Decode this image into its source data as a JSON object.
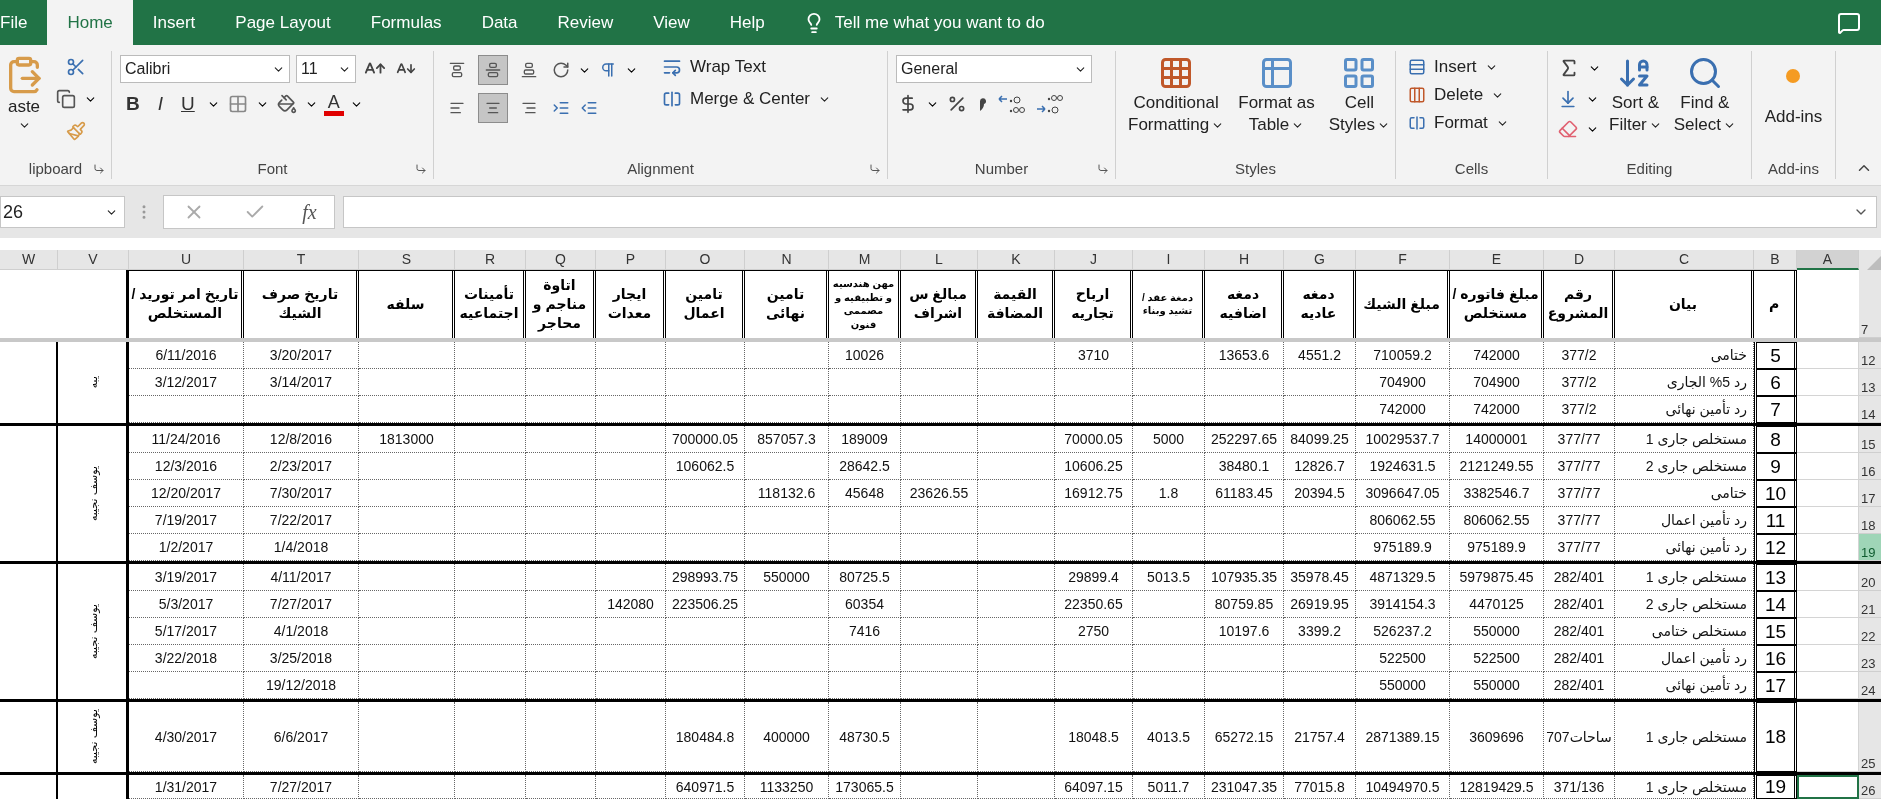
{
  "ribbon_tabs": [
    {
      "label": "File",
      "selected": false
    },
    {
      "label": "Home",
      "selected": true
    },
    {
      "label": "Insert",
      "selected": false
    },
    {
      "label": "Page Layout",
      "selected": false
    },
    {
      "label": "Formulas",
      "selected": false
    },
    {
      "label": "Data",
      "selected": false
    },
    {
      "label": "Review",
      "selected": false
    },
    {
      "label": "View",
      "selected": false
    },
    {
      "label": "Help",
      "selected": false
    }
  ],
  "tell_me": "Tell me what you want to do",
  "clipboard": {
    "paste_label": "aste",
    "group_label": "lipboard"
  },
  "font": {
    "name": "Calibri",
    "size": "11",
    "bold": "B",
    "italic": "I",
    "underline": "U",
    "font_color": "A",
    "group_label": "Font"
  },
  "alignment": {
    "buttons": [
      {
        "kind": "top",
        "on": false
      },
      {
        "kind": "middle",
        "on": true
      },
      {
        "kind": "bottom",
        "on": false
      },
      {
        "kind": "left",
        "on": false
      },
      {
        "kind": "center",
        "on": true
      },
      {
        "kind": "right",
        "on": false
      }
    ],
    "wrap_text": "Wrap Text",
    "merge_center": "Merge & Center",
    "group_label": "Alignment"
  },
  "number": {
    "format": "General",
    "group_label": "Number"
  },
  "styles": {
    "buttons": [
      {
        "lines": [
          "Conditional",
          "Formatting"
        ]
      },
      {
        "lines": [
          "Format as",
          "Table"
        ]
      },
      {
        "lines": [
          "Cell",
          "Styles"
        ]
      }
    ],
    "group_label": "Styles"
  },
  "cells": {
    "buttons": [
      "Insert",
      "Delete",
      "Format"
    ],
    "group_label": "Cells"
  },
  "editing": {
    "buttons": [
      {
        "lines": [
          "Sort &",
          "Filter"
        ]
      },
      {
        "lines": [
          "Find &",
          "Select"
        ]
      }
    ],
    "group_label": "Editing"
  },
  "add_ins": {
    "button": "Add-ins",
    "group_label": "Add-ins"
  },
  "formula_bar": {
    "name_box": "26",
    "fx": "fx"
  },
  "sheet": {
    "columns": [
      {
        "letter": "W",
        "selected": false
      },
      {
        "letter": "V",
        "selected": false
      },
      {
        "letter": "U",
        "selected": false
      },
      {
        "letter": "T",
        "selected": false
      },
      {
        "letter": "S",
        "selected": false
      },
      {
        "letter": "R",
        "selected": false
      },
      {
        "letter": "Q",
        "selected": false
      },
      {
        "letter": "P",
        "selected": false
      },
      {
        "letter": "O",
        "selected": false
      },
      {
        "letter": "N",
        "selected": false
      },
      {
        "letter": "M",
        "selected": false
      },
      {
        "letter": "L",
        "selected": false
      },
      {
        "letter": "K",
        "selected": false
      },
      {
        "letter": "J",
        "selected": false
      },
      {
        "letter": "I",
        "selected": false
      },
      {
        "letter": "H",
        "selected": false
      },
      {
        "letter": "G",
        "selected": false
      },
      {
        "letter": "F",
        "selected": false
      },
      {
        "letter": "E",
        "selected": false
      },
      {
        "letter": "D",
        "selected": false
      },
      {
        "letter": "C",
        "selected": false
      },
      {
        "letter": "B",
        "selected": false
      },
      {
        "letter": "A",
        "selected": true
      }
    ],
    "header_row": {
      "number": "7",
      "labels": {
        "U": {
          "text": "تاريخ امر توريد /المستخلص",
          "compact": false
        },
        "T": {
          "text": "تاريخ صرف الشيك",
          "compact": false
        },
        "S": {
          "text": "سلفه",
          "compact": false
        },
        "R": {
          "text": "تأمينات اجتماعيه",
          "compact": false
        },
        "Q": {
          "text": "اتاوة مناجم و محاجر",
          "compact": false
        },
        "P": {
          "text": "ايجار معدات",
          "compact": false
        },
        "O": {
          "text": "تامين اعمال",
          "compact": false
        },
        "N": {
          "text": "تامين نهائى",
          "compact": false
        },
        "M": {
          "text": "مهن هندسيه و تطبيقيه و مصممى فنون",
          "compact": true
        },
        "L": {
          "text": "مبالغ س اشراف",
          "compact": false
        },
        "K": {
          "text": "القيمة المضافة",
          "compact": false
        },
        "J": {
          "text": "ارباح تجاريه",
          "compact": false
        },
        "I": {
          "text": "دمغة عقد / تشيد وبناء",
          "compact": true
        },
        "H": {
          "text": "دمغه اضافيه",
          "compact": false
        },
        "G": {
          "text": "دمغه عاديه",
          "compact": false
        },
        "F": {
          "text": "مبلغ الشيك",
          "compact": false
        },
        "E": {
          "text": "مبلغ فاتوره / مستخلص",
          "compact": false
        },
        "D": {
          "text": "رقم المشروع",
          "compact": false
        },
        "C": {
          "text": "بيان",
          "compact": false
        },
        "B": {
          "text": "م",
          "compact": false
        }
      }
    },
    "groups": [
      {
        "label": "يبه",
        "rows": [
          {
            "number": "12",
            "selected": false,
            "active": false,
            "cells": {
              "U": "6/11/2016",
              "T": "3/20/2017",
              "M": "10026",
              "J": "3710",
              "H": "13653.6",
              "G": "4551.2",
              "F": "710059.2",
              "E": "742000",
              "D": "377/2",
              "C": "ختامى",
              "B": "5"
            }
          },
          {
            "number": "13",
            "selected": false,
            "active": false,
            "cells": {
              "U": "3/12/2017",
              "T": "3/14/2017",
              "F": "704900",
              "E": "704900",
              "D": "377/2",
              "C": "رد 5% الجارى",
              "B": "6"
            }
          },
          {
            "number": "14",
            "selected": false,
            "active": false,
            "cells": {
              "F": "742000",
              "E": "742000",
              "D": "377/2",
              "C": "رد تأمين نهائى",
              "B": "7"
            }
          }
        ]
      },
      {
        "label": "يوسف نجيبه",
        "rows": [
          {
            "number": "15",
            "selected": false,
            "active": false,
            "cells": {
              "U": "11/24/2016",
              "T": "12/8/2016",
              "S": "1813000",
              "O": "700000.05",
              "N": "857057.3",
              "M": "189009",
              "J": "70000.05",
              "I": "5000",
              "H": "252297.65",
              "G": "84099.25",
              "F": "10029537.7",
              "E": "14000001",
              "D": "377/77",
              "C": "مستخلص جارى 1",
              "B": "8"
            }
          },
          {
            "number": "16",
            "selected": false,
            "active": false,
            "cells": {
              "U": "12/3/2016",
              "T": "2/23/2017",
              "O": "106062.5",
              "M": "28642.5",
              "J": "10606.25",
              "H": "38480.1",
              "G": "12826.7",
              "F": "1924631.5",
              "E": "2121249.55",
              "D": "377/77",
              "C": "مستخلص جارى 2",
              "B": "9"
            }
          },
          {
            "number": "17",
            "selected": false,
            "active": false,
            "cells": {
              "U": "12/20/2017",
              "T": "7/30/2017",
              "N": "118132.6",
              "M": "45648",
              "L": "23626.55",
              "J": "16912.75",
              "I": "1.8",
              "H": "61183.45",
              "G": "20394.5",
              "F": "3096647.05",
              "E": "3382546.7",
              "D": "377/77",
              "C": "ختامى",
              "B": "10"
            }
          },
          {
            "number": "18",
            "selected": false,
            "active": false,
            "cells": {
              "U": "7/19/2017",
              "T": "7/22/2017",
              "F": "806062.55",
              "E": "806062.55",
              "D": "377/77",
              "C": "رد تأمين اعمال",
              "B": "11"
            }
          },
          {
            "number": "19",
            "selected": true,
            "active": false,
            "cells": {
              "U": "1/2/2017",
              "T": "1/4/2018",
              "F": "975189.9",
              "E": "975189.9",
              "D": "377/77",
              "C": "رد تأمين نهائى",
              "B": "12"
            }
          }
        ]
      },
      {
        "label": "يوسف نجيبه",
        "rows": [
          {
            "number": "20",
            "selected": false,
            "active": false,
            "cells": {
              "U": "3/19/2017",
              "T": "4/11/2017",
              "O": "298993.75",
              "N": "550000",
              "M": "80725.5",
              "J": "29899.4",
              "I": "5013.5",
              "H": "107935.35",
              "G": "35978.45",
              "F": "4871329.5",
              "E": "5979875.45",
              "D": "282/401",
              "C": "مستخلص جارى 1",
              "B": "13"
            }
          },
          {
            "number": "21",
            "selected": false,
            "active": false,
            "cells": {
              "U": "5/3/2017",
              "T": "7/27/2017",
              "P": "142080",
              "O": "223506.25",
              "M": "60354",
              "J": "22350.65",
              "H": "80759.85",
              "G": "26919.95",
              "F": "3914154.3",
              "E": "4470125",
              "D": "282/401",
              "C": "مستخلص جارى 2",
              "B": "14"
            }
          },
          {
            "number": "22",
            "selected": false,
            "active": false,
            "cells": {
              "U": "5/17/2017",
              "T": "4/1/2018",
              "M": "7416",
              "J": "2750",
              "H": "10197.6",
              "G": "3399.2",
              "F": "526237.2",
              "E": "550000",
              "D": "282/401",
              "C": "مستخلص ختامى",
              "B": "15"
            }
          },
          {
            "number": "23",
            "selected": false,
            "active": false,
            "cells": {
              "U": "3/22/2018",
              "T": "3/25/2018",
              "F": "522500",
              "E": "522500",
              "D": "282/401",
              "C": "رد تأمين اعمال",
              "B": "16"
            }
          },
          {
            "number": "24",
            "selected": false,
            "active": false,
            "cells": {
              "T": "19/12/2018",
              "F": "550000",
              "E": "550000",
              "D": "282/401",
              "C": "رد تأمين نهائى",
              "B": "17"
            }
          }
        ]
      },
      {
        "label": "يوسف نجيبه",
        "rows": [
          {
            "number": "25",
            "selected": false,
            "active": false,
            "cells": {
              "U": "4/30/2017",
              "T": "6/6/2017",
              "O": "180484.8",
              "N": "400000",
              "M": "48730.5",
              "J": "18048.5",
              "I": "4013.5",
              "H": "65272.15",
              "G": "21757.4",
              "F": "2871389.15",
              "E": "3609696",
              "D": "ساحات707",
              "C": "مستخلص جارى 1",
              "B": "18"
            }
          }
        ]
      },
      {
        "rows": [
          {
            "number": "26",
            "selected": false,
            "active": true,
            "cells": {
              "U": "1/31/2017",
              "T": "7/27/2017",
              "O": "640971.5",
              "N": "1133250",
              "M": "173065.5",
              "J": "64097.15",
              "I": "5011.7",
              "H": "231047.35",
              "G": "77015.8",
              "F": "10494970.5",
              "E": "12819429.5",
              "D": "371/136",
              "C": "مستخلص جارى 1",
              "B": "19"
            }
          }
        ]
      }
    ]
  }
}
